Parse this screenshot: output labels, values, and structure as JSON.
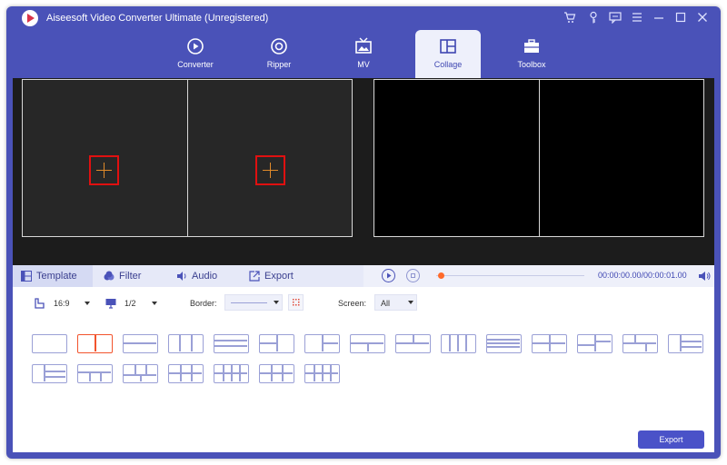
{
  "app": {
    "title": "Aiseesoft Video Converter Ultimate (Unregistered)"
  },
  "titlebar_icons": [
    "cart-icon",
    "key-icon",
    "chat-icon",
    "menu-icon",
    "minimize-icon",
    "maximize-icon",
    "close-icon"
  ],
  "nav": {
    "tabs": [
      {
        "label": "Converter",
        "icon": "converter-icon"
      },
      {
        "label": "Ripper",
        "icon": "ripper-icon"
      },
      {
        "label": "MV",
        "icon": "mv-icon"
      },
      {
        "label": "Collage",
        "icon": "collage-icon",
        "active": true
      },
      {
        "label": "Toolbox",
        "icon": "toolbox-icon"
      }
    ]
  },
  "edit_tabs": [
    {
      "label": "Template",
      "icon": "template-icon",
      "active": true
    },
    {
      "label": "Filter",
      "icon": "filter-icon"
    },
    {
      "label": "Audio",
      "icon": "audio-icon"
    },
    {
      "label": "Export",
      "icon": "export-icon"
    }
  ],
  "player": {
    "time": "00:00:00.00/00:00:01.00"
  },
  "settings": {
    "aspect": "16:9",
    "screen_ratio": "1/2",
    "border_label": "Border:",
    "screen_label": "Screen:",
    "screen_value": "All"
  },
  "templates": {
    "selected_index": 1
  },
  "footer": {
    "export_label": "Export"
  },
  "colors": {
    "accent": "#4a52b8",
    "highlight": "#f2542d",
    "add_border": "#e01010"
  }
}
